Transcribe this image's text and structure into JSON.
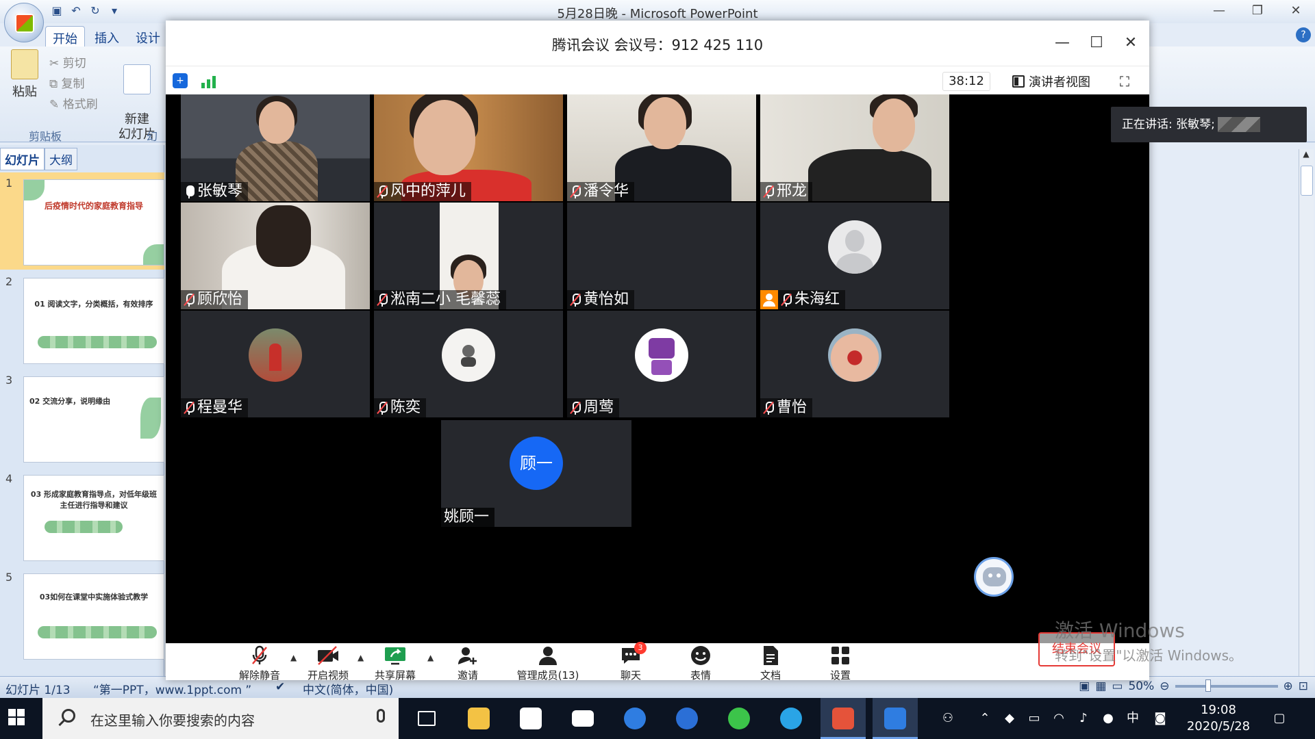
{
  "ppt": {
    "window_title": "5月28日晚 - Microsoft PowerPoint",
    "ribbon_tabs": [
      "开始",
      "插入",
      "设计"
    ],
    "clipboard": {
      "paste": "粘贴",
      "cut": "剪切",
      "copy": "复制",
      "format_painter": "格式刷",
      "group_label": "剪贴板"
    },
    "slides_group": {
      "new_slide": "新建\n幻灯片",
      "group_label": "幻"
    },
    "pane_tabs": [
      "幻灯片",
      "大纲"
    ],
    "thumbnails": [
      {
        "num": "1",
        "text": "后疫情时代的家庭教育指导"
      },
      {
        "num": "2",
        "text": "01 阅读文字，分类概括，有效排序"
      },
      {
        "num": "3",
        "text": "02 交流分享，说明缘由"
      },
      {
        "num": "4",
        "text": "03 形成家庭教育指导点，对低年级班主任进行指导和建议"
      },
      {
        "num": "5",
        "text": "03如何在课堂中实施体验式教学"
      }
    ],
    "status": {
      "slide_counter": "幻灯片 1/13",
      "theme": "“第一PPT，www.1ppt.com ”",
      "language": "中文(简体，中国)",
      "zoom": "50%"
    }
  },
  "meeting": {
    "title": "腾讯会议 会议号：912 425 110",
    "timer": "38:12",
    "presenter_view": "演讲者视图",
    "speaking_now": "正在讲话: 张敏琴;",
    "participants": [
      {
        "name": "张敏琴",
        "muted": false,
        "speaking": true
      },
      {
        "name": "风中的萍儿",
        "muted": true
      },
      {
        "name": "潘令华",
        "muted": true
      },
      {
        "name": "邢龙",
        "muted": true
      },
      {
        "name": "顾欣怡",
        "muted": true
      },
      {
        "name": "淞南二小 毛馨蕊",
        "muted": true
      },
      {
        "name": "黄怡如",
        "muted": true
      },
      {
        "name": "朱海红",
        "muted": true,
        "host": true
      },
      {
        "name": "程曼华",
        "muted": true
      },
      {
        "name": "陈奕",
        "muted": true
      },
      {
        "name": "周莺",
        "muted": true
      },
      {
        "name": "曹怡",
        "muted": true
      },
      {
        "name": "姚顾一",
        "avatar_text": "顾一"
      }
    ],
    "toolbar": {
      "unmute": "解除静音",
      "start_video": "开启视频",
      "share_screen": "共享屏幕",
      "invite": "邀请",
      "manage_members": "管理成员(13)",
      "chat": "聊天",
      "chat_badge": "3",
      "emoji": "表情",
      "docs": "文档",
      "settings": "设置",
      "end_meeting": "结束会议"
    },
    "accent_color": "#1668f5",
    "speaking_color": "#2f9e4f"
  },
  "watermark": {
    "line1": "激活 Windows",
    "line2": "转到\"设置\"以激活 Windows。"
  },
  "taskbar": {
    "search_placeholder": "在这里输入你要搜索的内容",
    "ime": "中",
    "time": "19:08",
    "date": "2020/5/28"
  }
}
